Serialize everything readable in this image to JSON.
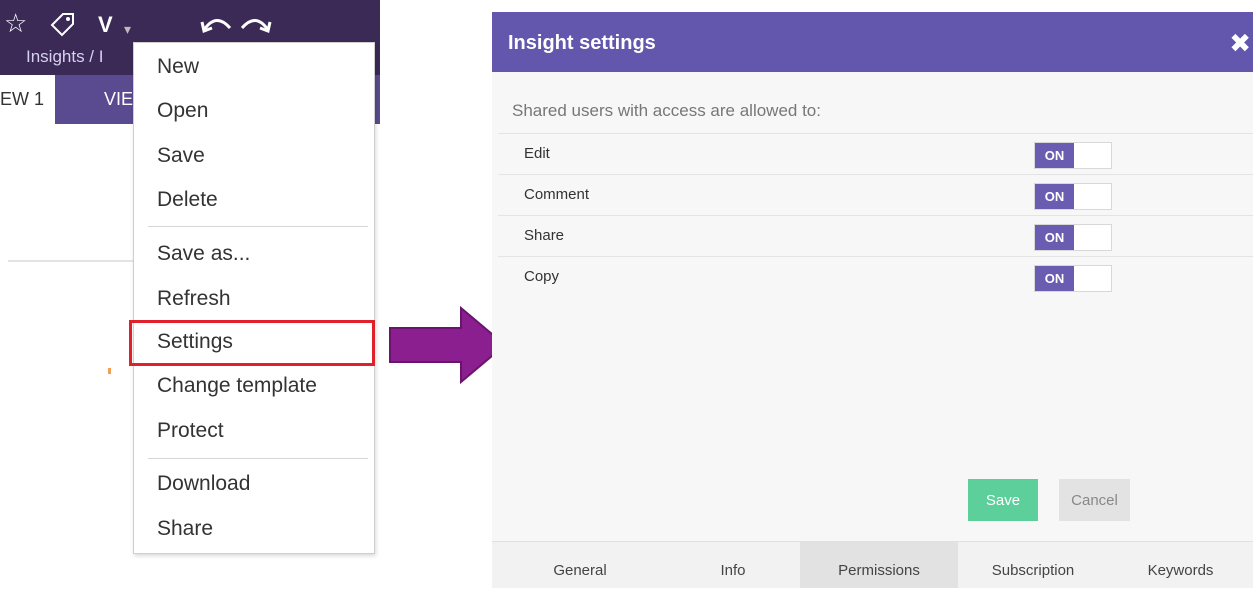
{
  "app": {
    "toolbar_icons": [
      "star-icon",
      "tag-icon",
      "undo-icon",
      "redo-icon"
    ],
    "toolbar_letter": "V",
    "breadcrumb": "Insights / I",
    "tabs": [
      {
        "label": "EW 1"
      },
      {
        "label": "VIE"
      }
    ]
  },
  "menu": {
    "items": [
      {
        "label": "New"
      },
      {
        "label": "Open"
      },
      {
        "label": "Save"
      },
      {
        "label": "Delete"
      },
      {
        "label": "Save as..."
      },
      {
        "label": "Refresh"
      },
      {
        "label": "Settings",
        "highlighted": true
      },
      {
        "label": "Change template"
      },
      {
        "label": "Protect"
      },
      {
        "label": "Download"
      },
      {
        "label": "Share"
      }
    ]
  },
  "dialog": {
    "title": "Insight settings",
    "subtitle": "Shared users with access are allowed to:",
    "permissions": [
      {
        "label": "Edit",
        "toggle": "ON"
      },
      {
        "label": "Comment",
        "toggle": "ON"
      },
      {
        "label": "Share",
        "toggle": "ON"
      },
      {
        "label": "Copy",
        "toggle": "ON"
      }
    ],
    "save_label": "Save",
    "cancel_label": "Cancel",
    "tabs": [
      {
        "label": "General"
      },
      {
        "label": "Info"
      },
      {
        "label": "Permissions",
        "active": true
      },
      {
        "label": "Subscription"
      },
      {
        "label": "Keywords"
      }
    ]
  },
  "colors": {
    "dialog_header": "#6256ad",
    "toggle_on": "#6a5cb0",
    "save_button": "#5ccf9b",
    "highlight_box": "#e0202a",
    "arrow": "#8b1f8f"
  }
}
